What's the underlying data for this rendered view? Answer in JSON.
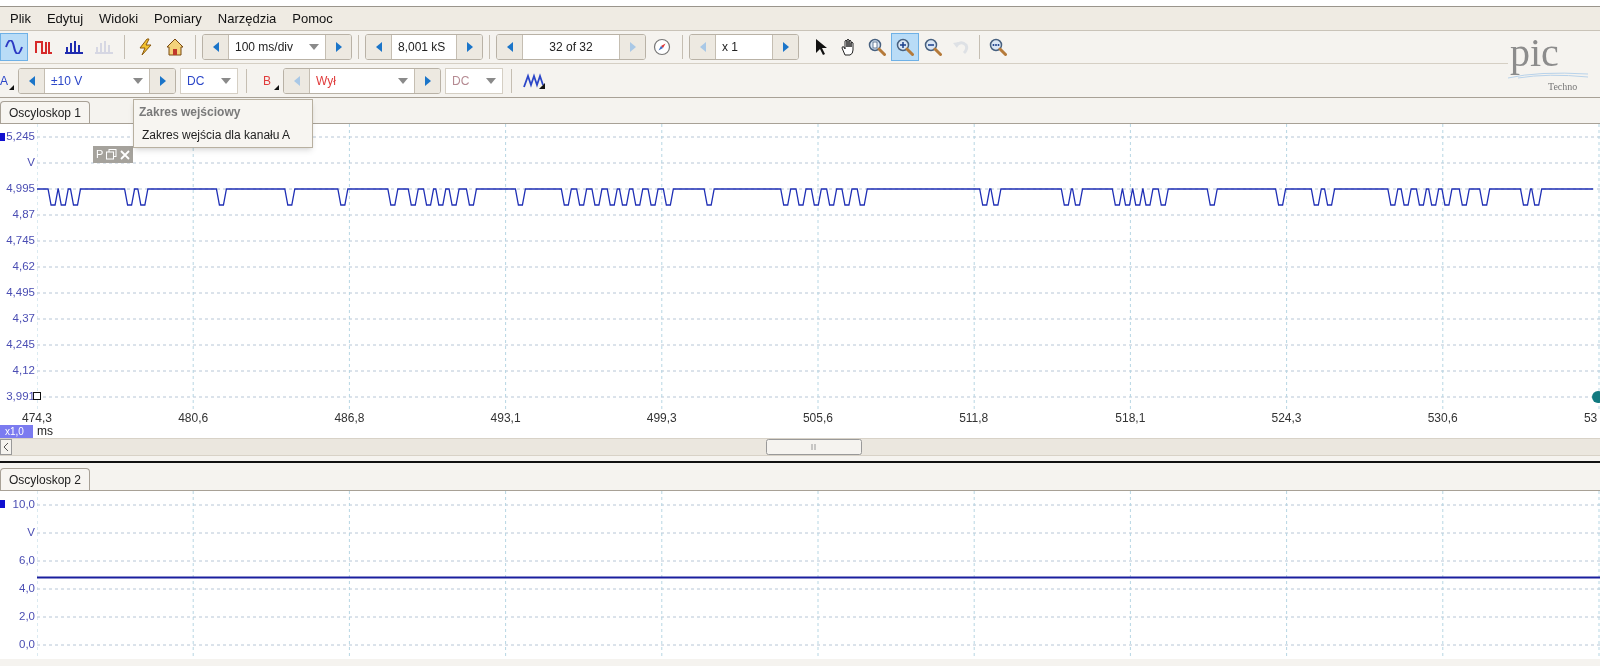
{
  "menu": [
    {
      "label": "Plik"
    },
    {
      "label": "Edytuj"
    },
    {
      "label": "Widoki"
    },
    {
      "label": "Pomiary"
    },
    {
      "label": "Narzędzia"
    },
    {
      "label": "Pomoc"
    }
  ],
  "toolbar": {
    "mode_buttons": [
      {
        "kind": "scope",
        "selected": true,
        "disabled": false
      },
      {
        "kind": "persistence",
        "selected": false,
        "disabled": false
      },
      {
        "kind": "spectrum",
        "selected": false,
        "disabled": false
      },
      {
        "kind": "spectrum",
        "selected": false,
        "disabled": true
      }
    ],
    "action_buttons": [
      {
        "kind": "auto-setup"
      },
      {
        "kind": "home"
      }
    ],
    "timebase": {
      "value": "100 ms/div"
    },
    "samples": {
      "value": "8,001 kS"
    },
    "buffer": {
      "value": "32 of 32",
      "prev_disabled": false,
      "next_disabled": true
    },
    "zoom": {
      "value": "x 1",
      "prev_disabled": true,
      "next_disabled": false
    },
    "tools": [
      {
        "kind": "pointer",
        "selected": false,
        "disabled": false
      },
      {
        "kind": "hand",
        "selected": false,
        "disabled": false
      },
      {
        "kind": "zoom-area",
        "selected": false,
        "disabled": false
      },
      {
        "kind": "zoom-in",
        "selected": true,
        "disabled": false
      },
      {
        "kind": "zoom-out",
        "selected": false,
        "disabled": false
      },
      {
        "kind": "undo",
        "selected": false,
        "disabled": true
      },
      {
        "kind": "zoom-fit",
        "selected": false,
        "disabled": false
      }
    ]
  },
  "logo": {
    "text": "pic",
    "subtitle": "Techno"
  },
  "channels": [
    {
      "name": "A",
      "color": "#2b46c8",
      "range": "±10 V",
      "coupling": "DC",
      "enabled": true
    },
    {
      "name": "B",
      "color": "#e03b3b",
      "range": "Wył",
      "coupling": "DC",
      "enabled": false
    }
  ],
  "tooltip": {
    "title": "Zakres wejściowy",
    "text": "Zakres wejścia dla kanału A"
  },
  "scopes": [
    {
      "tab": "Oscyloskop 1",
      "selected": true,
      "kind": "pulses",
      "y_labels": [
        "5,245",
        "V",
        "4,995",
        "4,87",
        "4,745",
        "4,62",
        "4,495",
        "4,37",
        "4,245",
        "4,12",
        "3,991"
      ],
      "x_labels": [
        "474,3",
        "480,6",
        "486,8",
        "493,1",
        "499,3",
        "505,6",
        "511,8",
        "518,1",
        "524,3",
        "530,6",
        "53"
      ],
      "x_unit": "ms",
      "zoom_badge": "x1,0",
      "float_label": "P"
    },
    {
      "tab": "Oscyloskop 2",
      "selected": true,
      "kind": "flat",
      "y_labels": [
        "10,0",
        "V",
        "6,0",
        "4,0",
        "2,0",
        "0,0"
      ]
    }
  ]
}
